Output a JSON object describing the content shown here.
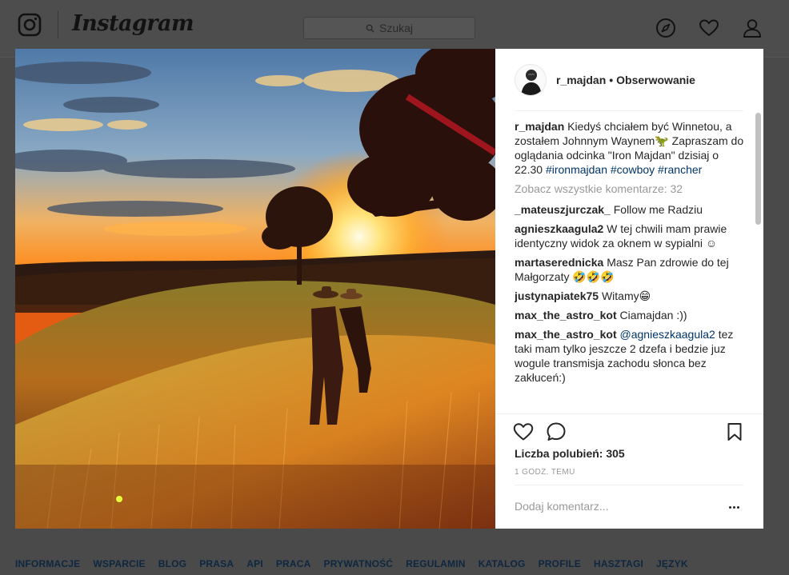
{
  "header": {
    "brand": "Instagram",
    "search_placeholder": "Szukaj"
  },
  "post": {
    "author": "r_majdan",
    "separator": "•",
    "follow_label": "Obserwowanie",
    "caption": {
      "user": "r_majdan",
      "text_before": "Kiedyś chciałem być Winnetou, a zostałem Johnnym Waynem🦖 Zapraszam do oglądania odcinka \"Iron Majdan\" dzisiaj o 22.30 ",
      "tag1": "#ironmajdan",
      "tag2": "#cowboy",
      "tag3": "#rancher"
    },
    "view_all_comments": "Zobacz wszystkie komentarze: 32",
    "comments": [
      {
        "user": "_mateuszjurczak_",
        "text": "Follow me Radziu"
      },
      {
        "user": "agnieszkaagula2",
        "text": "W tej chwili mam prawie identyczny widok za oknem w sypialni ☺"
      },
      {
        "user": "martaserednicka",
        "text": "Masz Pan zdrowie do tej Małgorzaty 🤣🤣🤣"
      },
      {
        "user": "justynapiatek75",
        "text": "Witamy😁"
      },
      {
        "user": "max_the_astro_kot",
        "text": "Ciamajdan :))"
      },
      {
        "user": "max_the_astro_kot",
        "mention": "@agnieszkaagula2",
        "text": "tez taki mam tylko jeszcze 2 dzefa i bedzie juz wogule transmisja zachodu słonca bez zakłuceń:)"
      }
    ],
    "likes": "Liczba polubień: 305",
    "time": "1 GODZ. TEMU",
    "add_comment_placeholder": "Dodaj komentarz..."
  },
  "footer": {
    "links": [
      "INFORMACJE",
      "WSPARCIE",
      "BLOG",
      "PRASA",
      "API",
      "PRACA",
      "PRYWATNOŚĆ",
      "REGULAMIN",
      "KATALOG",
      "PROFILE",
      "HASZTAGI",
      "JĘZYK"
    ]
  },
  "icons": {
    "logo": "instagram-camera-icon",
    "search": "search-icon",
    "explore": "compass-icon",
    "activity": "heart-icon",
    "profile": "user-icon",
    "like": "heart-outline-icon",
    "comment": "speech-bubble-icon",
    "save": "bookmark-icon",
    "more": "ellipsis-icon"
  },
  "colors": {
    "overlay": "#4a4a4a",
    "panel": "#ffffff",
    "link": "#003569",
    "muted": "#999999",
    "sunset": "#ff9a1f"
  }
}
